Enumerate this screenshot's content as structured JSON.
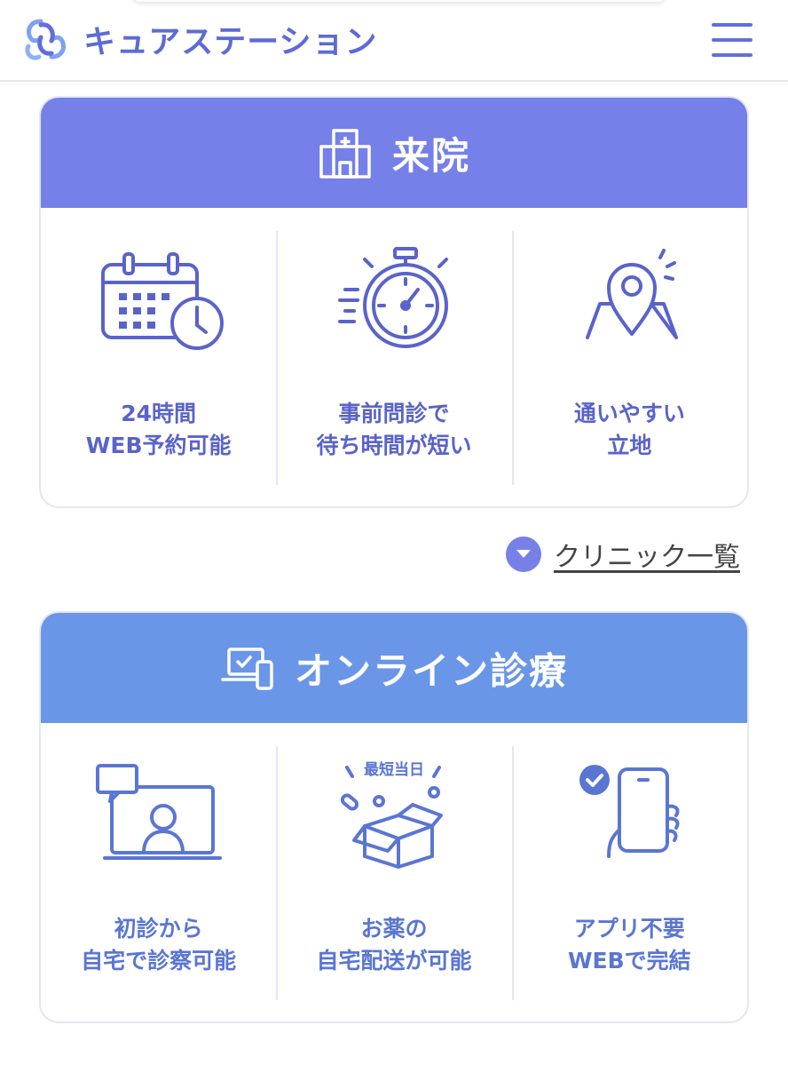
{
  "header": {
    "logo_text": "キュアステーション"
  },
  "visit": {
    "title": "来院",
    "features": [
      {
        "line1": "24時間",
        "line2": "WEB予約可能"
      },
      {
        "line1": "事前問診で",
        "line2": "待ち時間が短い"
      },
      {
        "line1": "通いやすい",
        "line2": "立地"
      }
    ],
    "clinic_link_label": "クリニック一覧"
  },
  "online": {
    "title": "オンライン診療",
    "features": [
      {
        "line1": "初診から",
        "line2": "自宅で診察可能"
      },
      {
        "line1": "お薬の",
        "line2": "自宅配送が可能"
      },
      {
        "line1": "アプリ不要",
        "line2": "WEBで完結"
      }
    ],
    "box_caption": "最短当日"
  },
  "colors": {
    "visit_header": "#7580e8",
    "online_header": "#6a96e8",
    "icon_stroke": "#5a63c9"
  }
}
